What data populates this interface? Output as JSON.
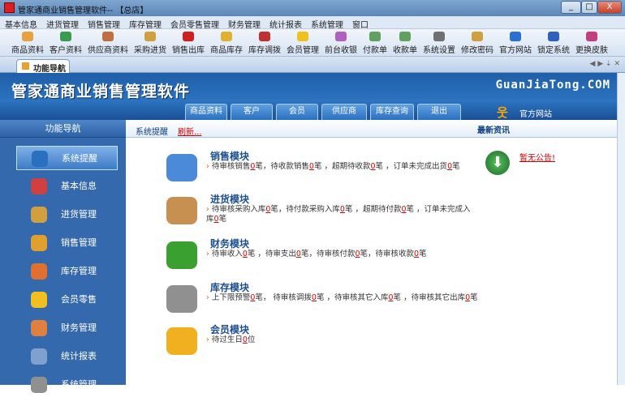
{
  "window": {
    "title": "管家通商业销售管理软件-- 【总店】",
    "minimize": "_",
    "maximize": "□",
    "close": "X"
  },
  "menu": [
    "基本信息",
    "进货管理",
    "销售管理",
    "库存管理",
    "会员零售管理",
    "财务管理",
    "统计报表",
    "系统管理",
    "窗口"
  ],
  "toolbar": [
    {
      "label": "商品资料",
      "color": "#e8a040"
    },
    {
      "label": "客户资料",
      "color": "#3a9a50"
    },
    {
      "label": "供应商资料",
      "color": "#c07040"
    },
    {
      "label": "采购进货",
      "color": "#d0a040"
    },
    {
      "label": "销售出库",
      "color": "#d02020"
    },
    {
      "label": "商品库存",
      "color": "#e0b030"
    },
    {
      "label": "库存调拨",
      "color": "#c03030"
    },
    {
      "label": "会员管理",
      "color": "#f0c020"
    },
    {
      "label": "前台收银",
      "color": "#b060c0"
    },
    {
      "label": "付款单",
      "color": "#60a060"
    },
    {
      "label": "收款单",
      "color": "#60a060"
    },
    {
      "label": "系统设置",
      "color": "#707070"
    },
    {
      "label": "修改密码",
      "color": "#d0a040"
    },
    {
      "label": "官方网站",
      "color": "#2a70d0"
    },
    {
      "label": "锁定系统",
      "color": "#3060c0"
    },
    {
      "label": "更换皮肤",
      "color": "#c04080"
    }
  ],
  "tab": {
    "label": "功能导航"
  },
  "banner": {
    "title": "管家通商业销售管理软件",
    "site": "GuanJiaTong.COM",
    "tabs": [
      "商品资料",
      "客户",
      "会员",
      "供应商",
      "库存查询",
      "退出"
    ],
    "official": "官方网站"
  },
  "sidebar": {
    "header": "功能导航",
    "items": [
      {
        "label": "系统提醒",
        "color": "#2a70c0"
      },
      {
        "label": "基本信息",
        "color": "#d04040"
      },
      {
        "label": "进货管理",
        "color": "#d0a040"
      },
      {
        "label": "销售管理",
        "color": "#e0a030"
      },
      {
        "label": "库存管理",
        "color": "#e07030"
      },
      {
        "label": "会员零售",
        "color": "#f0c020"
      },
      {
        "label": "财务管理",
        "color": "#e08040"
      },
      {
        "label": "统计报表",
        "color": "#80a0d0"
      },
      {
        "label": "系统管理",
        "color": "#909090"
      }
    ]
  },
  "main": {
    "header": "系统提醒",
    "refresh": "刷新...",
    "news": "最新资讯",
    "notice": "暂无公告!",
    "modules": [
      {
        "title": "销售模块",
        "color": "#4a8ad8",
        "parts": [
          "待审核销售",
          "0",
          "笔，待收款销售",
          "0",
          "笔 ，超期待收款",
          "0",
          "笔 ，订单未完成出货",
          "0",
          "笔"
        ]
      },
      {
        "title": "进货模块",
        "color": "#c89050",
        "parts": [
          "待审核采购入库",
          "0",
          "笔，待付款采购入库",
          "0",
          "笔 ，超期待付款",
          "0",
          "笔 ，订单未完成入库",
          "0",
          "笔"
        ]
      },
      {
        "title": "财务模块",
        "color": "#3aa030",
        "parts": [
          "待审收入",
          "0",
          "笔 ，待审支出",
          "0",
          "笔，待审核付款",
          "0",
          "笔，待审核收款",
          "0",
          "笔"
        ]
      },
      {
        "title": "库存模块",
        "color": "#909090",
        "parts": [
          "上下限预警",
          "0",
          "笔， 待审核调拨",
          "0",
          "笔 ，待审核其它入库",
          "0",
          "笔 ，待审核其它出库",
          "0",
          "笔"
        ]
      },
      {
        "title": "会员模块",
        "color": "#f0b020",
        "parts": [
          "待过生日",
          "0",
          "位"
        ]
      }
    ]
  }
}
